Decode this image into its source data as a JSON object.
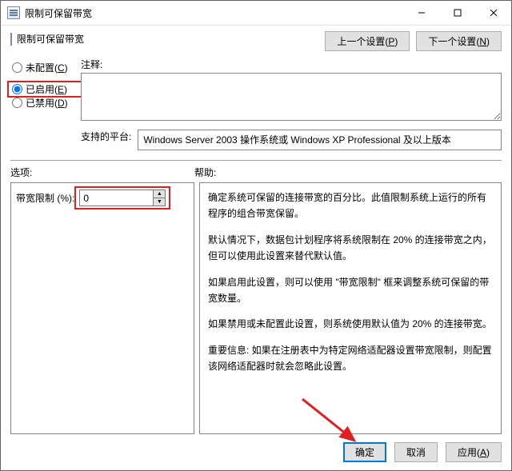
{
  "window": {
    "title": "限制可保留带宽"
  },
  "header": {
    "title": "限制可保留带宽"
  },
  "nav": {
    "prev": "上一个设置(P)",
    "next": "下一个设置(N)"
  },
  "radios": {
    "not_configured": "未配置(C)",
    "enabled": "已启用(E)",
    "disabled": "已禁用(D)",
    "selected": "enabled"
  },
  "labels": {
    "comment": "注释:",
    "platform": "支持的平台:",
    "options": "选项:",
    "help": "帮助:",
    "bandwidth_limit": "带宽限制 (%):"
  },
  "fields": {
    "comment_value": "",
    "platform_value": "Windows Server 2003 操作系统或 Windows XP Professional 及以上版本",
    "bandwidth_value": "0"
  },
  "help_text": {
    "p1": "确定系统可保留的连接带宽的百分比。此值限制系统上运行的所有程序的组合带宽保留。",
    "p2": "默认情况下，数据包计划程序将系统限制在 20% 的连接带宽之内，但可以使用此设置来替代默认值。",
    "p3": "如果启用此设置，则可以使用 \"带宽限制\" 框来调整系统可保留的带宽数量。",
    "p4": "如果禁用或未配置此设置，则系统使用默认值为 20% 的连接带宽。",
    "p5": "重要信息: 如果在注册表中为特定网络适配器设置带宽限制，则配置该网络适配器时就会忽略此设置。"
  },
  "footer": {
    "ok": "确定",
    "cancel": "取消",
    "apply": "应用(A)"
  }
}
